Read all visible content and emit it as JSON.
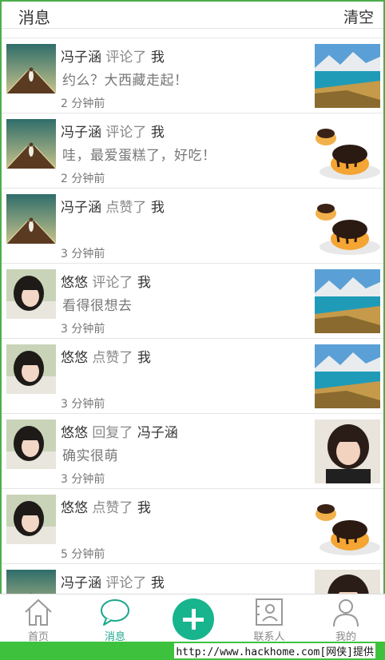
{
  "header": {
    "title": "消息",
    "clear_label": "清空"
  },
  "messages": [
    {
      "user": "冯子涵",
      "action": "评论了",
      "target": "我",
      "content": "约么？大西藏走起！",
      "time": "2 分钟前",
      "avatar": "road-girl",
      "thumb": "lake"
    },
    {
      "user": "冯子涵",
      "action": "评论了",
      "target": "我",
      "content": "哇，最爱蛋糕了，好吃！",
      "time": "2 分钟前",
      "avatar": "road-girl",
      "thumb": "cake"
    },
    {
      "user": "冯子涵",
      "action": "点赞了",
      "target": "我",
      "content": "",
      "time": "3 分钟前",
      "avatar": "road-girl",
      "thumb": "cake"
    },
    {
      "user": "悠悠",
      "action": "评论了",
      "target": "我",
      "content": "看得很想去",
      "time": "3 分钟前",
      "avatar": "child",
      "thumb": "lake"
    },
    {
      "user": "悠悠",
      "action": "点赞了",
      "target": "我",
      "content": "",
      "time": "3 分钟前",
      "avatar": "child",
      "thumb": "lake"
    },
    {
      "user": "悠悠",
      "action": "回复了",
      "target": "冯子涵",
      "content": "确实很萌",
      "time": "3 分钟前",
      "avatar": "child",
      "thumb": "girl-photo"
    },
    {
      "user": "悠悠",
      "action": "点赞了",
      "target": "我",
      "content": "",
      "time": "5 分钟前",
      "avatar": "child",
      "thumb": "cake"
    },
    {
      "user": "冯子涵",
      "action": "评论了",
      "target": "我",
      "content": "",
      "time": "",
      "avatar": "road-girl",
      "thumb": "girl-photo"
    }
  ],
  "nav": {
    "home": "首页",
    "messages": "消息",
    "contacts": "联系人",
    "me": "我的"
  },
  "colors": {
    "accent": "#18b48e",
    "active_text": "#1aa88c",
    "watermark_bg": "#3ec23e"
  },
  "watermark": "http://www.hackhome.com[网侠]提供"
}
